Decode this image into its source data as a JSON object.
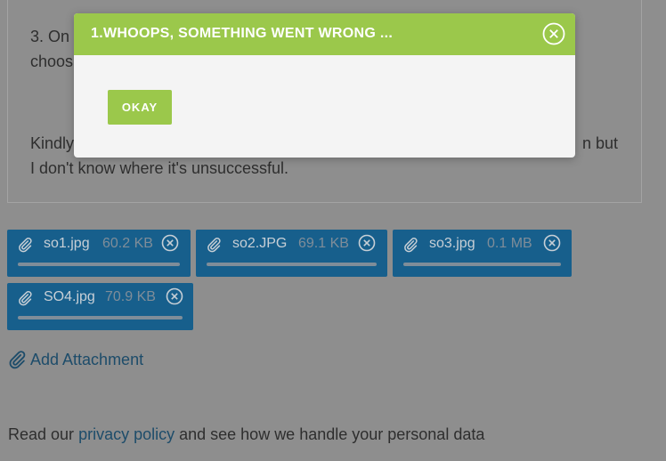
{
  "message": {
    "line1": "3. On t",
    "line2": "choos",
    "line3": "Kindly",
    "line3_tail": "n but",
    "line4": "I don't know where it's unsuccessful."
  },
  "attachments": [
    {
      "name": "so1.jpg",
      "size": "60.2 KB"
    },
    {
      "name": "so2.JPG",
      "size": "69.1 KB"
    },
    {
      "name": "so3.jpg",
      "size": "0.1 MB"
    },
    {
      "name": "SO4.jpg",
      "size": "70.9 KB"
    }
  ],
  "add_attachment_label": "Add Attachment",
  "privacy": {
    "prefix": "Read our ",
    "link": "privacy policy",
    "suffix": " and see how we handle your personal data"
  },
  "modal": {
    "title": "1.WHOOPS, SOMETHING WENT WRONG ...",
    "button": "OKAY"
  },
  "colors": {
    "accent_green": "#9bc84b",
    "chip_blue": "#175f8c",
    "link_blue": "#1d4c6a"
  },
  "icons": {
    "attachment": "paperclip-icon",
    "remove": "circle-x-icon",
    "close": "circle-x-icon"
  }
}
